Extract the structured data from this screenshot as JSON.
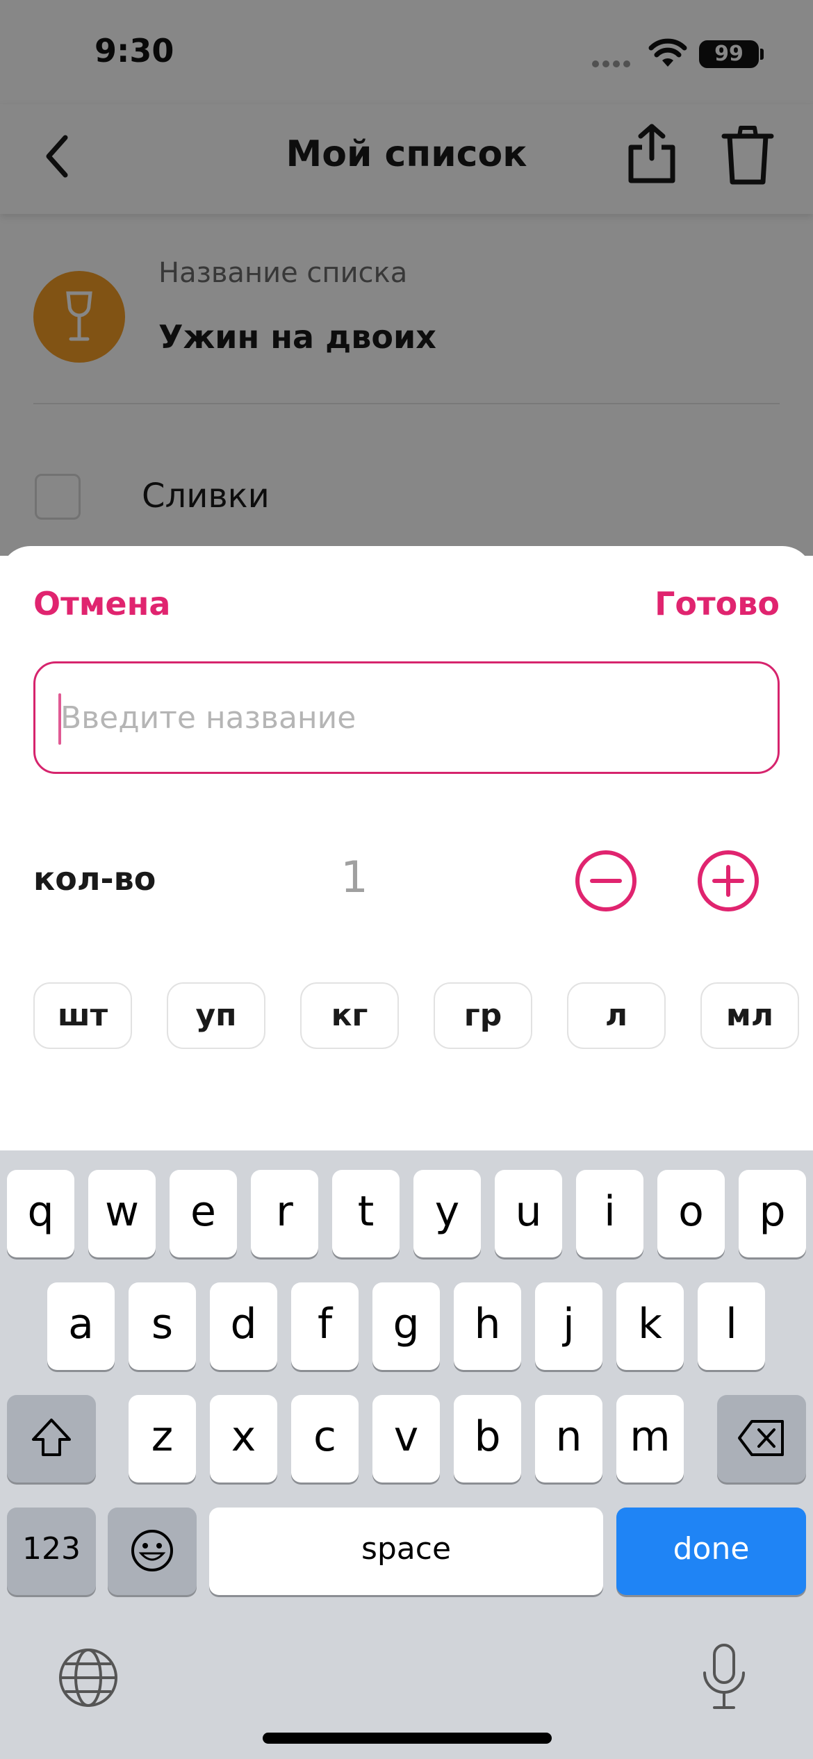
{
  "status_bar": {
    "time": "9:30",
    "battery": "99"
  },
  "nav": {
    "title": "Мой список"
  },
  "list": {
    "name_label": "Название списка",
    "name_value": "Ужин на двоих",
    "avatar_color": "#f39d26",
    "items": [
      {
        "label": "Сливки",
        "checked": false
      }
    ]
  },
  "sheet": {
    "cancel_label": "Отмена",
    "done_label": "Готово",
    "name_input": {
      "value": "",
      "placeholder": "Введите название"
    },
    "quantity": {
      "label": "кол-во",
      "value": "1"
    },
    "units": [
      "шт",
      "уп",
      "кг",
      "гр",
      "л",
      "мл"
    ],
    "accent_color": "#e0246f"
  },
  "keyboard": {
    "row1": [
      "q",
      "w",
      "e",
      "r",
      "t",
      "y",
      "u",
      "i",
      "o",
      "p"
    ],
    "row2": [
      "a",
      "s",
      "d",
      "f",
      "g",
      "h",
      "j",
      "k",
      "l"
    ],
    "row3": [
      "z",
      "x",
      "c",
      "v",
      "b",
      "n",
      "m"
    ],
    "numbers_label": "123",
    "space_label": "space",
    "done_label": "done",
    "done_color": "#1f84f5"
  }
}
